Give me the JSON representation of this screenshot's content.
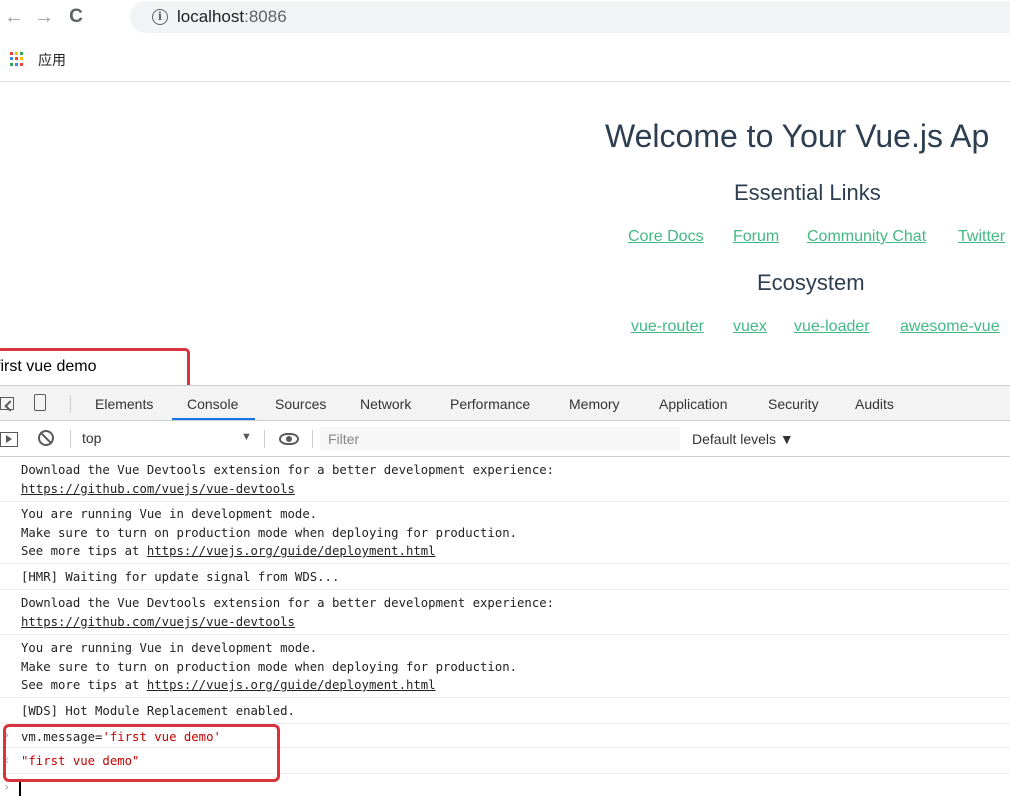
{
  "browser": {
    "url_host": "localhost",
    "url_port": ":8086",
    "bookmarks_apps_label": "应用"
  },
  "page": {
    "title": "Welcome to Your Vue.js Ap",
    "essential_heading": "Essential Links",
    "essential_links": [
      "Core Docs",
      "Forum",
      "Community Chat",
      "Twitter"
    ],
    "ecosystem_heading": "Ecosystem",
    "ecosystem_links": [
      "vue-router",
      "vuex",
      "vue-loader",
      "awesome-vue"
    ],
    "message": "first vue demo"
  },
  "devtools": {
    "tabs": [
      "Elements",
      "Console",
      "Sources",
      "Network",
      "Performance",
      "Memory",
      "Application",
      "Security",
      "Audits"
    ],
    "active_tab": "Console",
    "context": "top",
    "filter_placeholder": "Filter",
    "levels": "Default levels ▼",
    "console": {
      "m1_line1": "Download the Vue Devtools extension for a better development experience:",
      "m1_link": "https://github.com/vuejs/vue-devtools",
      "m2_line1": "You are running Vue in development mode.",
      "m2_line2": "Make sure to turn on production mode when deploying for production.",
      "m2_line3_prefix": "See more tips at ",
      "m2_link": "https://vuejs.org/guide/deployment.html",
      "m3": "[HMR] Waiting for update signal from WDS...",
      "m4_line1": "Download the Vue Devtools extension for a better development experience:",
      "m4_link": "https://github.com/vuejs/vue-devtools",
      "m5_line1": "You are running Vue in development mode.",
      "m5_line2": "Make sure to turn on production mode when deploying for production.",
      "m5_line3_prefix": "See more tips at ",
      "m5_link": "https://vuejs.org/guide/deployment.html",
      "m6": "[WDS] Hot Module Replacement enabled.",
      "input_prefix": "vm.message=",
      "input_value": "'first vue demo'",
      "result": "\"first vue demo\""
    }
  },
  "colors": {
    "vue_green": "#42b983",
    "vue_text": "#2c3e50",
    "highlight_red": "#d9333f",
    "console_string_red": "#c80000",
    "tab_active_blue": "#1a73e8"
  }
}
